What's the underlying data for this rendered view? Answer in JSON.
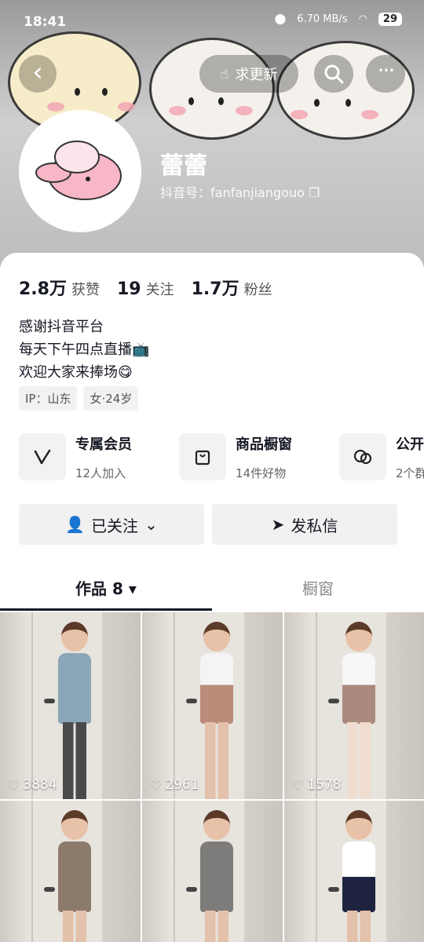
{
  "status": {
    "time": "18:41",
    "network": "6.70 MB/s",
    "battery": "29"
  },
  "header": {
    "refresh_label": "求更新"
  },
  "profile": {
    "name": "蕾蕾",
    "douyin_id": "抖音号：fanfanjiangouo"
  },
  "stats": [
    {
      "num": "2.8万",
      "label": "获赞"
    },
    {
      "num": "19",
      "label": "关注"
    },
    {
      "num": "1.7万",
      "label": "粉丝"
    }
  ],
  "bio": {
    "line1": "感谢抖音平台",
    "line2": "每天下午四点直播📺",
    "line3": "欢迎大家来捧场😋"
  },
  "tags": [
    "IP：山东",
    "女·24岁"
  ],
  "features": [
    {
      "title": "专属会员",
      "sub": "12人加入",
      "icon": "v-icon"
    },
    {
      "title": "商品橱窗",
      "sub": "14件好物",
      "icon": "shopping-bag-icon"
    },
    {
      "title": "公开",
      "sub": "2个群",
      "icon": "chat-icon"
    }
  ],
  "actions": {
    "follow": "已关注",
    "message": "发私信"
  },
  "tabs": {
    "works": "作品 8",
    "shop": "橱窗"
  },
  "videos": [
    {
      "likes": "3884",
      "outfit": "#8aa6b8"
    },
    {
      "likes": "2961",
      "outfit": "#f4f4f4"
    },
    {
      "likes": "1578",
      "outfit": "#f7f7f7"
    },
    {
      "likes": "",
      "outfit": "#8c7b6b"
    },
    {
      "likes": "",
      "outfit": "#7d7c7a"
    },
    {
      "likes": "",
      "outfit": "#ffffff"
    }
  ]
}
